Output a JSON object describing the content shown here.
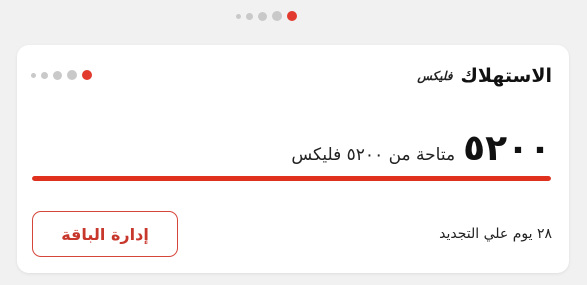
{
  "pager": {
    "count": 5,
    "active_index": 4
  },
  "card": {
    "brand_logo": "فليكس",
    "title": "الاستهلاك",
    "amount": "٥٢٠٠",
    "amount_description": "متاحة من ٥٢٠٠ فليكس",
    "progress_fraction": 1.0,
    "renewal_text": "٢٨ يوم علي التجديد",
    "manage_button_label": "إدارة الباقة",
    "pager": {
      "count": 5,
      "active_index": 4
    }
  },
  "colors": {
    "accent": "#e0301e",
    "inactive_dot": "#c9c9c9",
    "background": "#f1f1f1",
    "card": "#ffffff"
  }
}
